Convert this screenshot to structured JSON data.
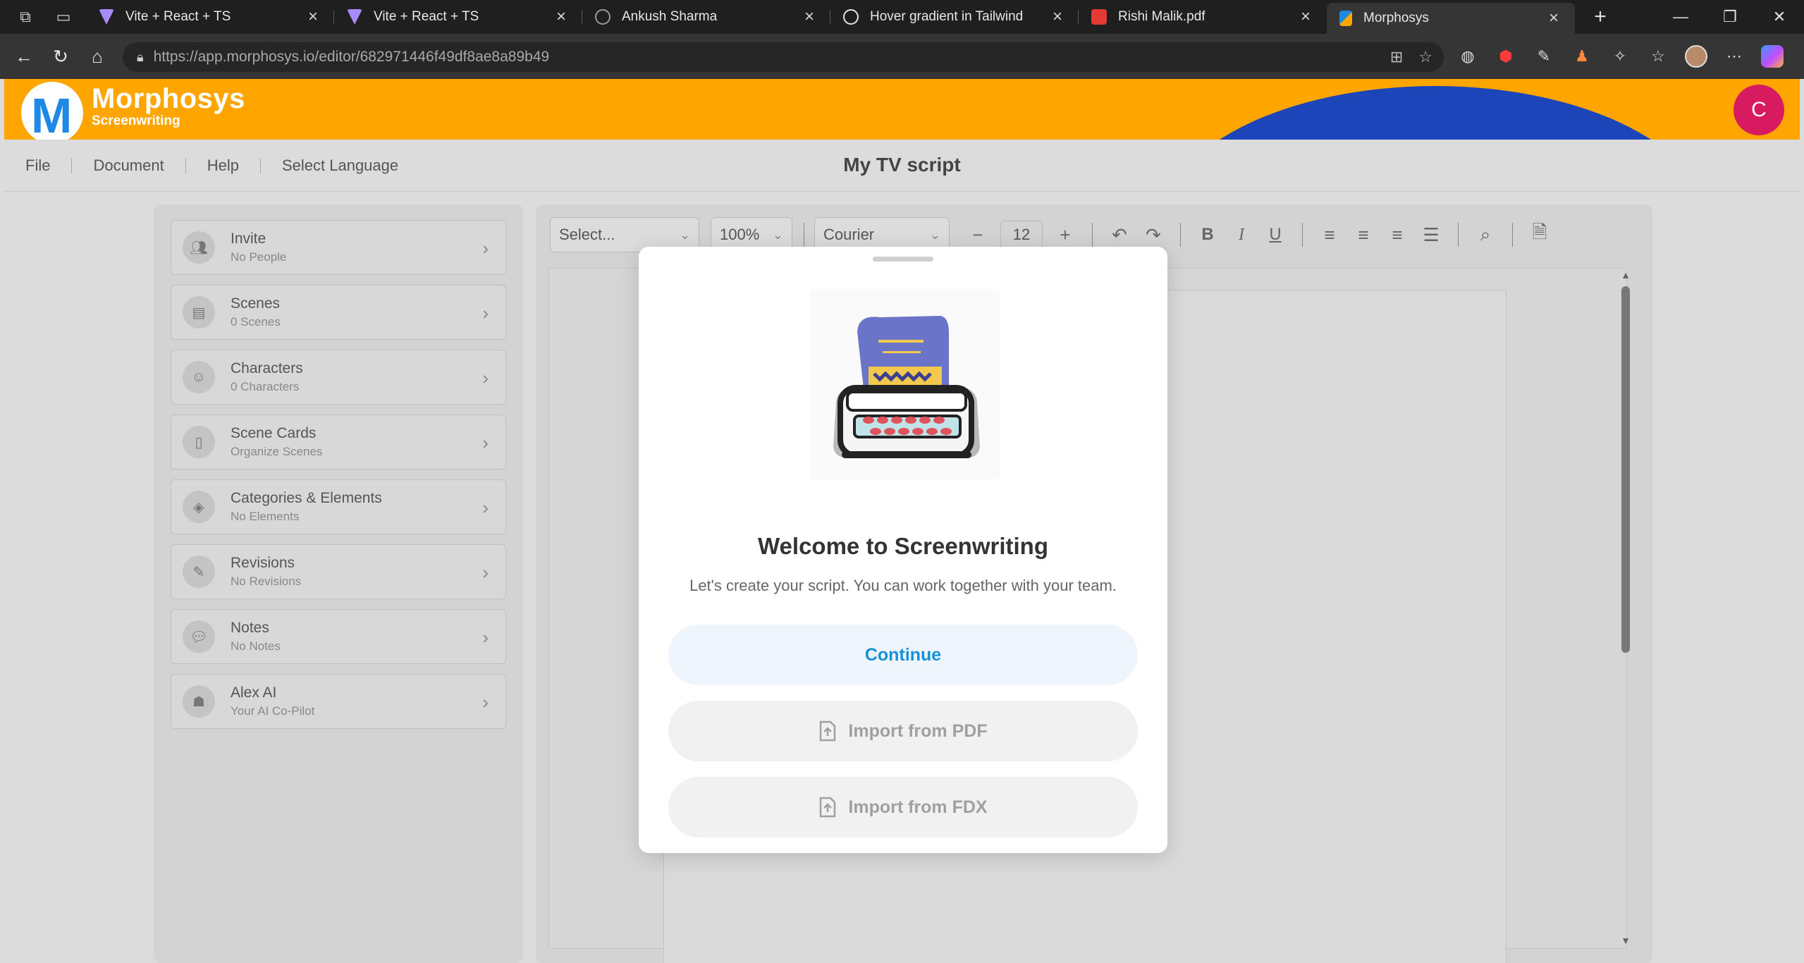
{
  "browser": {
    "tabs": [
      {
        "title": "Vite + React + TS",
        "favicon_color": "#a78bfa",
        "active": false
      },
      {
        "title": "Vite + React + TS",
        "favicon_color": "#a78bfa",
        "active": false
      },
      {
        "title": "Ankush Sharma",
        "favicon_color": "#8a8a8a",
        "active": false
      },
      {
        "title": "Hover gradient in Tailwind",
        "favicon_color": "#e5e5e5",
        "active": false
      },
      {
        "title": "Rishi Malik.pdf",
        "favicon_color": "#e53935",
        "active": false
      },
      {
        "title": "Morphosys",
        "favicon_color": "#ffa500",
        "active": true
      }
    ],
    "url_host": "https://app.morphosys.io",
    "url_path": "/editor/682971446f49df8ae8a89b49"
  },
  "app": {
    "brand_name": "Morphosys",
    "brand_sub": "Screenwriting",
    "logo_letter": "M",
    "avatar_letter": "C",
    "colors": {
      "header": "#ffa500",
      "arc": "#1b45b8",
      "avatar": "#d81b60",
      "accent": "#1691d9"
    }
  },
  "menu": {
    "items": [
      "File",
      "Document",
      "Help",
      "Select Language"
    ],
    "doc_title": "My TV script"
  },
  "sidebar": {
    "items": [
      {
        "title": "Invite",
        "subtitle": "No People",
        "icon": "people-icon"
      },
      {
        "title": "Scenes",
        "subtitle": "0 Scenes",
        "icon": "clapper-icon"
      },
      {
        "title": "Characters",
        "subtitle": "0 Characters",
        "icon": "smiley-icon"
      },
      {
        "title": "Scene Cards",
        "subtitle": "Organize Scenes",
        "icon": "cards-icon"
      },
      {
        "title": "Categories & Elements",
        "subtitle": "No Elements",
        "icon": "layers-icon"
      },
      {
        "title": "Revisions",
        "subtitle": "No Revisions",
        "icon": "pen-icon"
      },
      {
        "title": "Notes",
        "subtitle": "No Notes",
        "icon": "chat-icon"
      },
      {
        "title": "Alex AI",
        "subtitle": "Your AI Co-Pilot",
        "icon": "ai-head-icon"
      }
    ]
  },
  "toolbar": {
    "element_select": "Select...",
    "zoom": "100%",
    "font": "Courier",
    "font_size": "12"
  },
  "modal": {
    "title": "Welcome to Screenwriting",
    "subtitle": "Let's create your script. You can work together with your team.",
    "continue_label": "Continue",
    "import_pdf_label": "Import from PDF",
    "import_fdx_label": "Import from FDX"
  }
}
